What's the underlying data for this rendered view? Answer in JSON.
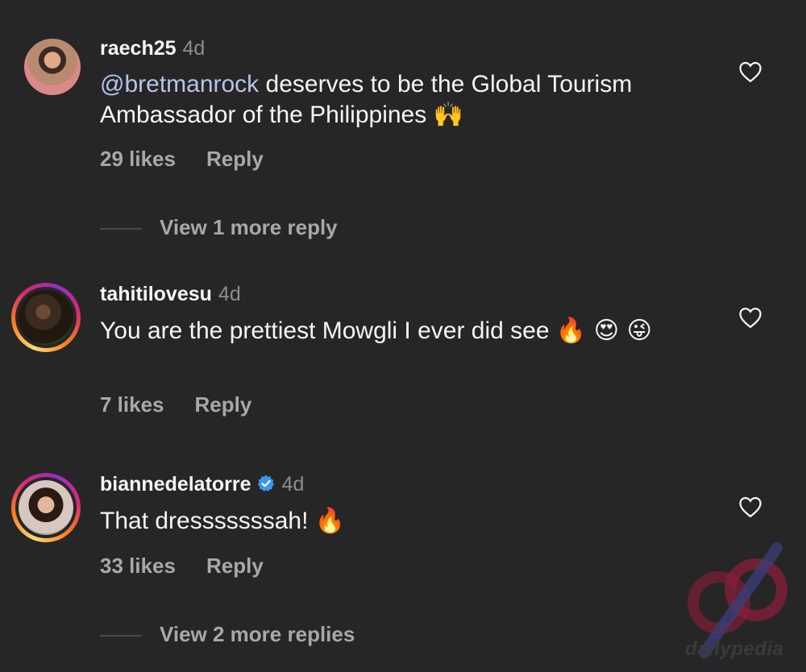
{
  "comments": [
    {
      "username": "raech25",
      "time": "4d",
      "mention": "@bretmanrock",
      "text": " deserves to be the Global Tourism Ambassador of the Philippines",
      "emoji": "🙌",
      "likes": "29 likes",
      "reply": "Reply",
      "view_more": "View 1 more reply"
    },
    {
      "username": "tahitilovesu",
      "time": "4d",
      "text": "You are the prettiest Mowgli I ever did see",
      "emoji": "🔥 😍 😜",
      "likes": "7 likes",
      "reply": "Reply"
    },
    {
      "username": "biannedelatorre",
      "time": "4d",
      "text": "That dresssssssah!",
      "emoji": "🔥",
      "likes": "33 likes",
      "reply": "Reply",
      "view_more": "View 2 more replies"
    }
  ],
  "icons": {
    "heart": "heart-icon",
    "verified": "verified-badge-icon"
  },
  "watermark": {
    "text": "dailypedia"
  },
  "colors": {
    "background": "#262626",
    "mention": "#b6c3ec",
    "secondary": "#a8a8a8",
    "verified": "#3897f0"
  }
}
